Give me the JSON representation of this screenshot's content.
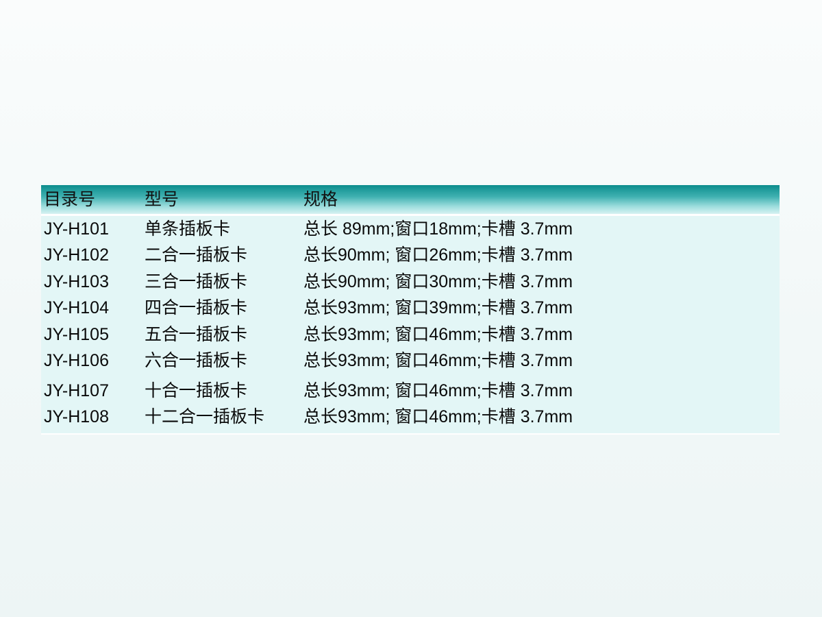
{
  "table": {
    "headers": [
      "目录号",
      "型号",
      "规格"
    ],
    "rows": [
      [
        "JY-H101",
        "单条插板卡",
        "总长 89mm;窗口18mm;卡槽 3.7mm"
      ],
      [
        "JY-H102",
        "二合一插板卡",
        "总长90mm; 窗口26mm;卡槽 3.7mm"
      ],
      [
        "JY-H103",
        "三合一插板卡",
        "总长90mm; 窗口30mm;卡槽 3.7mm"
      ],
      [
        "JY-H104",
        "四合一插板卡",
        "总长93mm; 窗口39mm;卡槽 3.7mm"
      ],
      [
        "JY-H105",
        "五合一插板卡",
        "总长93mm; 窗口46mm;卡槽 3.7mm"
      ],
      [
        "JY-H106",
        "六合一插板卡",
        "总长93mm; 窗口46mm;卡槽 3.7mm"
      ],
      [
        "JY-H107",
        "十合一插板卡",
        "总长93mm; 窗口46mm;卡槽 3.7mm"
      ],
      [
        "JY-H108",
        "十二合一插板卡",
        "总长93mm; 窗口46mm;卡槽 3.7mm"
      ]
    ]
  },
  "colors": {
    "header_dark": "#0c8d8d",
    "header_light": "#d6f2f2",
    "row_background": "#e3f6f6"
  }
}
